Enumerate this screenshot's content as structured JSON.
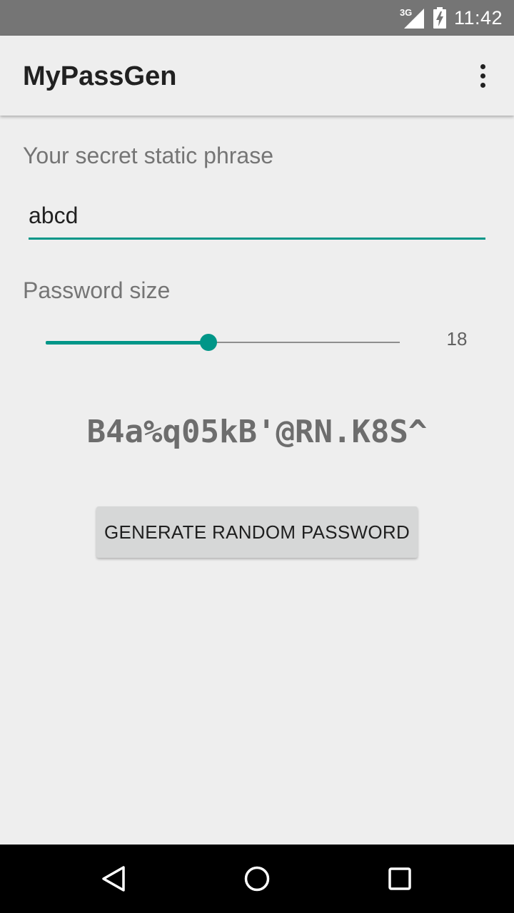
{
  "status_bar": {
    "network_type": "3G",
    "time": "11:42",
    "icons": [
      "signal-icon",
      "battery-charging-icon"
    ]
  },
  "app_bar": {
    "title": "MyPassGen",
    "overflow_icon": "more-vert-icon"
  },
  "form": {
    "phrase_label": "Your secret static phrase",
    "phrase_value": "abcd",
    "size_label": "Password size",
    "size_value": "18",
    "slider_fraction": 0.46
  },
  "password": "B4a%q05kB'@RN.K8S^",
  "generate_button_label": "GENERATE RANDOM PASSWORD",
  "nav_bar": {
    "icons": [
      "back-icon",
      "home-icon",
      "recents-icon"
    ]
  },
  "colors": {
    "accent": "#009688",
    "status_bar": "#757575",
    "background": "#eeeeee"
  }
}
